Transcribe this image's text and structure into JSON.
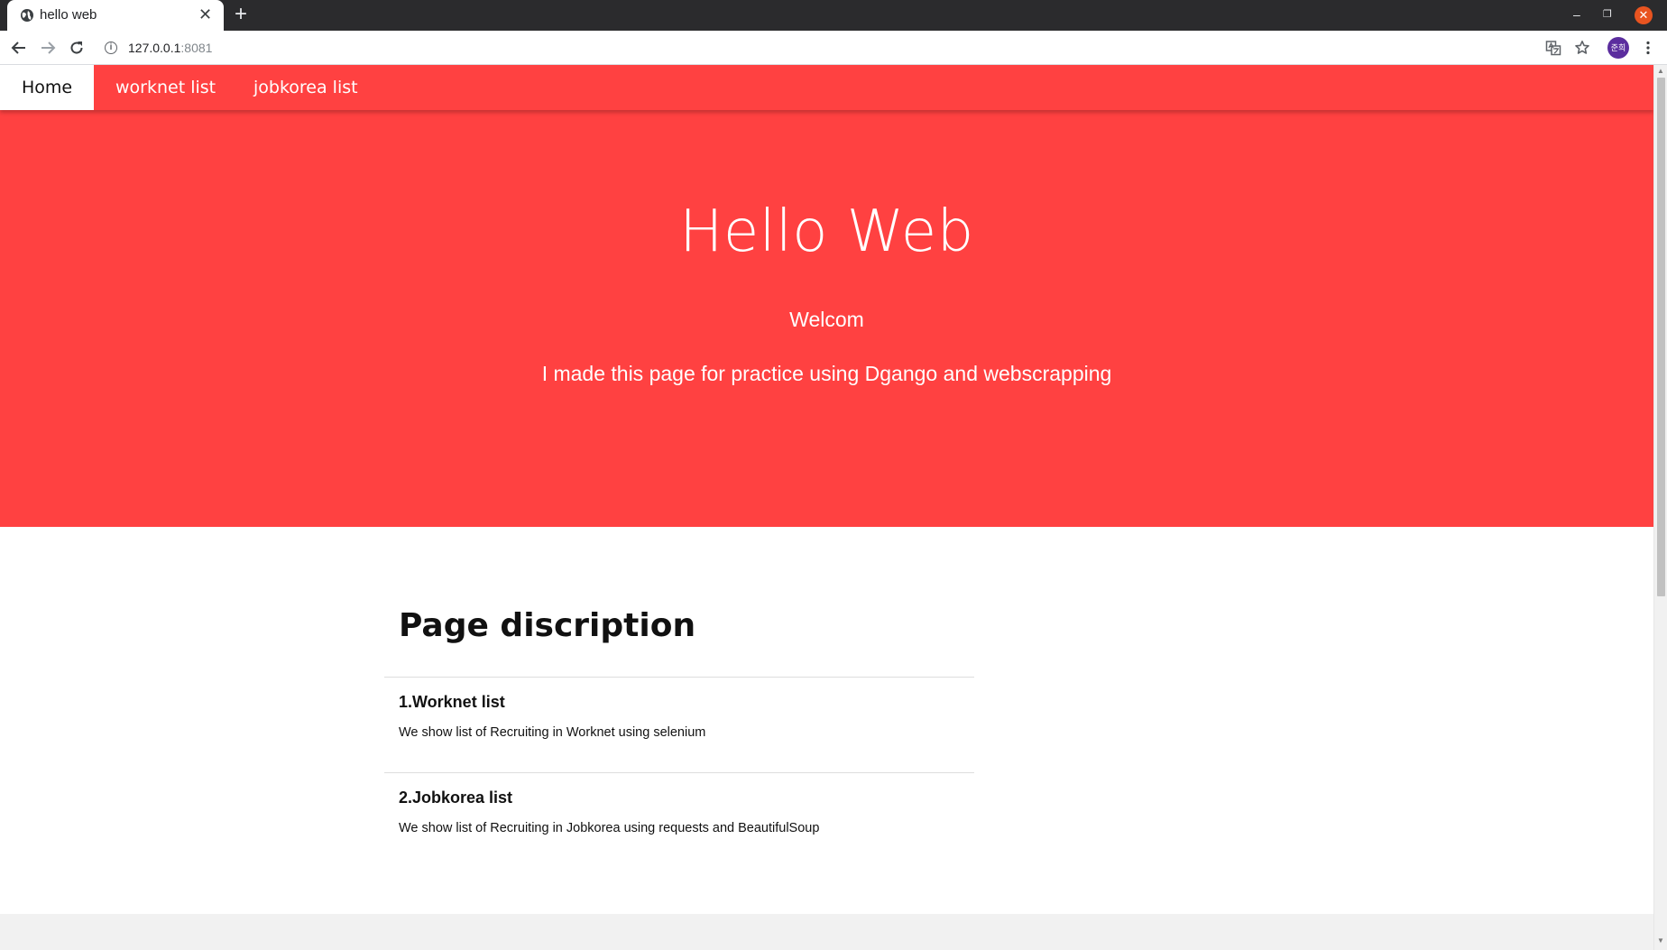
{
  "browser": {
    "tab_title": "hello web",
    "tab_close": "✕",
    "new_tab": "+",
    "url_host": "127.0.0.1",
    "url_port": ":8081",
    "minimize": "–",
    "restore": "❐",
    "close": "✕",
    "avatar_text": "준희"
  },
  "nav": {
    "items": [
      {
        "label": "Home",
        "active": true
      },
      {
        "label": "worknet list",
        "active": false
      },
      {
        "label": "jobkorea list",
        "active": false
      }
    ]
  },
  "hero": {
    "title": "Hello Web",
    "subtitle": "Welcom",
    "description": "I made this page for practice using Dgango and webscrapping"
  },
  "content": {
    "title": "Page discription",
    "items": [
      {
        "title": "1.Worknet list",
        "text": "We show list of Recruiting in Worknet using selenium"
      },
      {
        "title": "2.Jobkorea list",
        "text": "We show list of Recruiting in Jobkorea using requests and BeautifulSoup"
      }
    ]
  },
  "colors": {
    "brand_red": "#ff4141",
    "tab_strip": "#2b2b2d",
    "avatar": "#5b2d9e",
    "window_close": "#e95420"
  }
}
